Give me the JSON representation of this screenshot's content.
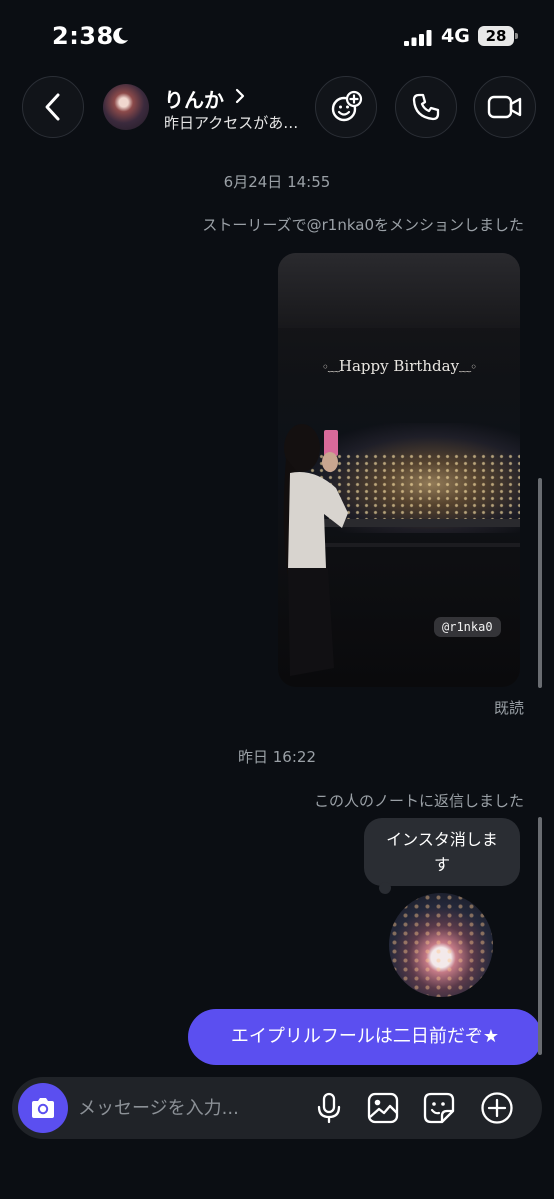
{
  "status_bar": {
    "time": "2:38",
    "network": "4G",
    "battery": "28"
  },
  "header": {
    "name": "りんか",
    "status": "昨日アクセスがあ…"
  },
  "thread": {
    "date1": "6月24日 14:55",
    "story_mention": "ストーリーズで@r1nka0をメンションしました",
    "story_text": "Happy Birthday",
    "story_tag": "@r1nka0",
    "seen": "既読",
    "date2": "昨日 16:22",
    "note_reply": "この人のノートに返信しました",
    "note_text_line1": "インスタ消しま",
    "note_text_line2": "す",
    "sent_message": "エイプリルフールは二日前だぞ★"
  },
  "composer": {
    "placeholder": "メッセージを入力..."
  },
  "colors": {
    "accent": "#5b4ff0",
    "background": "#0b0e13"
  },
  "icons": [
    "moon-icon",
    "signal-icon",
    "back-icon",
    "stickers-plus-icon",
    "phone-icon",
    "video-icon",
    "camera-icon",
    "mic-icon",
    "gallery-icon",
    "sticker-icon",
    "plus-icon"
  ]
}
